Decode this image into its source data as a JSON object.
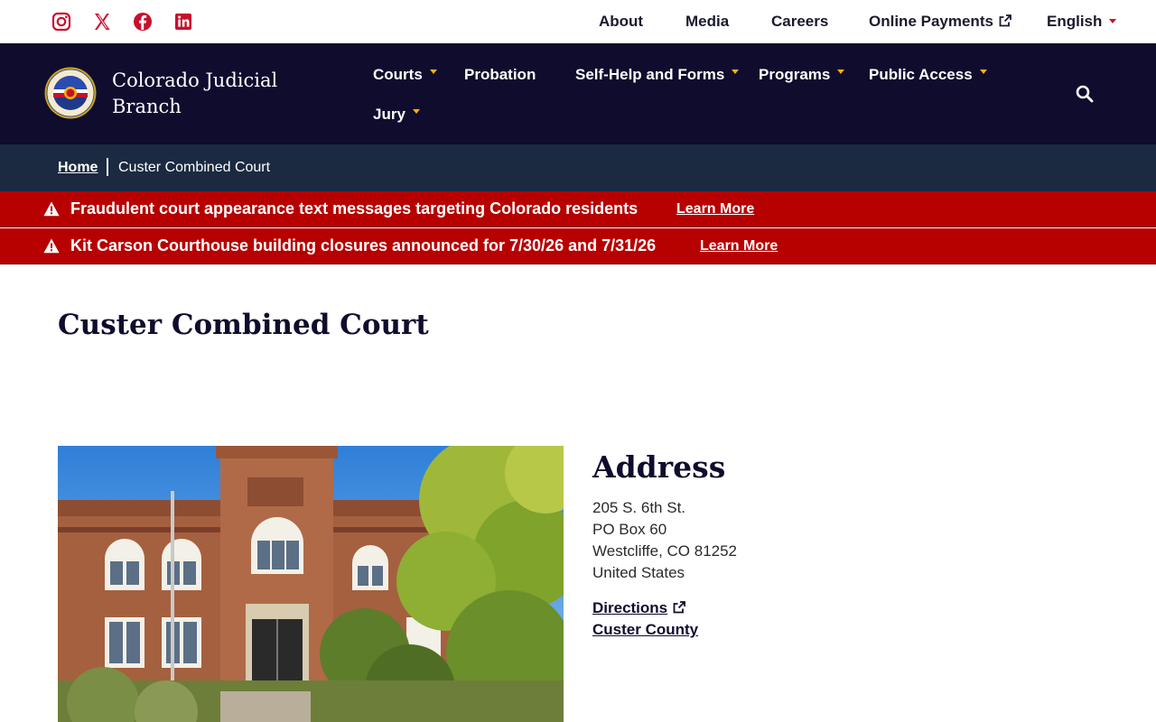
{
  "colors": {
    "brand_navy": "#0f0c2e",
    "breadcrumb_bg": "#1b2a41",
    "alert_red": "#b70000",
    "social_red": "#c8102e",
    "nav_caret_gold": "#f5b400"
  },
  "social_icons": [
    "instagram-icon",
    "x-icon",
    "facebook-icon",
    "linkedin-icon"
  ],
  "utility_nav": {
    "about": "About",
    "media": "Media",
    "careers": "Careers",
    "online_payments": "Online Payments",
    "language": "English"
  },
  "header": {
    "brand_line1": "Colorado Judicial",
    "brand_line2": "Branch",
    "nav": {
      "courts": "Courts",
      "probation": "Probation",
      "self_help": "Self-Help and Forms",
      "programs": "Programs",
      "public_access": "Public Access",
      "jury": "Jury"
    }
  },
  "breadcrumb": {
    "home": "Home",
    "current": "Custer Combined Court"
  },
  "alerts": [
    {
      "text": "Fraudulent court appearance text messages targeting Colorado residents",
      "link": "Learn More"
    },
    {
      "text": "Kit Carson Courthouse building closures announced for 7/30/26 and 7/31/26",
      "link": "Learn More"
    }
  ],
  "page": {
    "title": "Custer Combined Court"
  },
  "address": {
    "heading": "Address",
    "street": "205 S. 6th St.",
    "po_box": "PO Box 60",
    "city_state_zip": "Westcliffe, CO 81252",
    "country": "United States",
    "directions_link": "Directions",
    "county_link": "Custer County"
  }
}
